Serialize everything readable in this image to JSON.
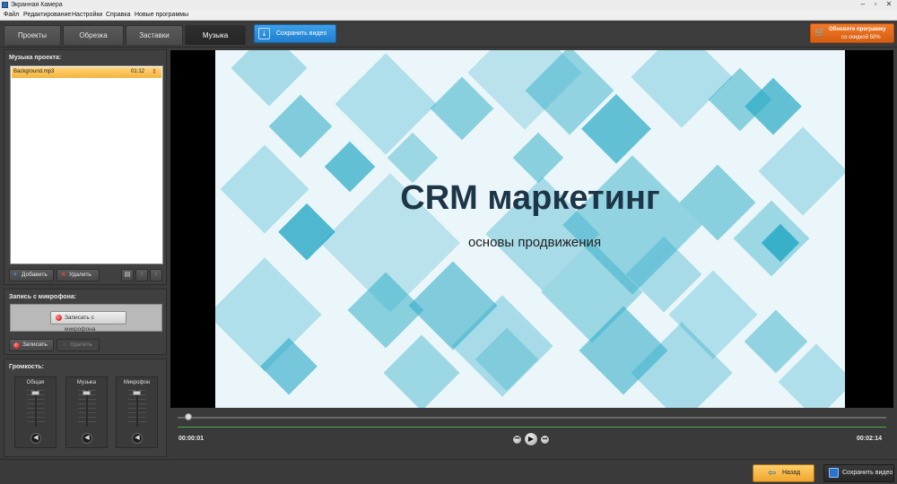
{
  "window": {
    "title": "Экранная Камера",
    "controls": [
      "–",
      "▫",
      "✕"
    ]
  },
  "menu": [
    "Файл",
    "Редактирование",
    "Настройки",
    "Справка",
    "Новые программы"
  ],
  "tabs": [
    {
      "label": "Проекты",
      "active": false
    },
    {
      "label": "Обрезка",
      "active": false
    },
    {
      "label": "Заставки",
      "active": false
    },
    {
      "label": "Музыка",
      "active": true
    }
  ],
  "toolbar": {
    "save_video": "Сохранить видео"
  },
  "upgrade": {
    "line1": "Обновите программу",
    "line2": "со скидкой 50%"
  },
  "music": {
    "title": "Музыка проекта:",
    "items": [
      {
        "name": "Background.mp3",
        "duration": "01:12"
      }
    ],
    "add": "Добавить",
    "delete": "Удалить"
  },
  "mic": {
    "title": "Запись с микрофона:",
    "record_from_mic": "Записать с микрофона",
    "record": "Записать",
    "delete": "Удалить"
  },
  "volume": {
    "title": "Громкость:",
    "channels": [
      "Общая",
      "Музыка",
      "Микрофон"
    ]
  },
  "preview": {
    "title": "CRM маркетинг",
    "subtitle": "основы продвижения"
  },
  "player": {
    "current_time": "00:00:01",
    "total_time": "00:02:14",
    "progress": 0.01
  },
  "footer": {
    "back": "Назад",
    "save_video": "Сохранить видео"
  },
  "colors": {
    "accent_blue": "#1f7fd0",
    "accent_orange": "#e06a1a",
    "diamond_teal": "#28a9c6"
  }
}
